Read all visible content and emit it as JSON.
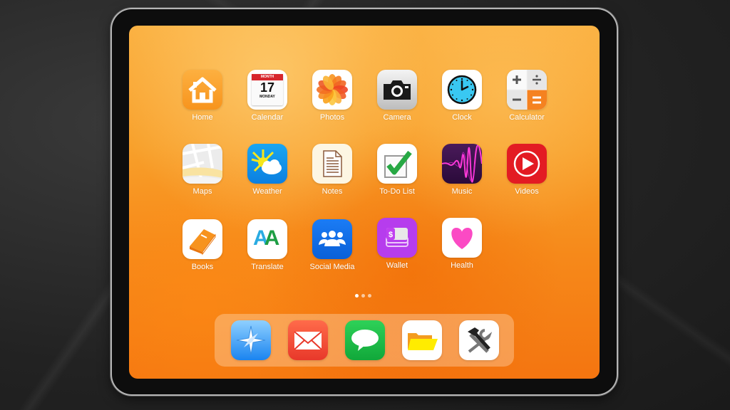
{
  "home_screen": {
    "apps": [
      {
        "label": "Home",
        "icon": "house-icon"
      },
      {
        "label": "Calendar",
        "icon": "calendar-icon",
        "month": "MONTH",
        "day": "17",
        "weekday": "MONDAY"
      },
      {
        "label": "Photos",
        "icon": "photos-flower-icon"
      },
      {
        "label": "Camera",
        "icon": "camera-icon"
      },
      {
        "label": "Clock",
        "icon": "clock-icon"
      },
      {
        "label": "Calculator",
        "icon": "calculator-icon"
      },
      {
        "label": "Maps",
        "icon": "map-icon"
      },
      {
        "label": "Weather",
        "icon": "sun-cloud-icon"
      },
      {
        "label": "Notes",
        "icon": "document-icon"
      },
      {
        "label": "To-Do List",
        "icon": "checkbox-icon"
      },
      {
        "label": "Music",
        "icon": "waveform-icon"
      },
      {
        "label": "Videos",
        "icon": "play-icon"
      },
      {
        "label": "Books",
        "icon": "book-icon"
      },
      {
        "label": "Translate",
        "icon": "translate-aa-icon",
        "glyph": "AA"
      },
      {
        "label": "Social Media",
        "icon": "people-icon"
      },
      {
        "label": "Wallet",
        "icon": "wallet-icon",
        "glyph": "$"
      },
      {
        "label": "Health",
        "icon": "heart-icon"
      }
    ],
    "page_indicator": {
      "pages": 3,
      "current": 1
    }
  },
  "dock": {
    "apps": [
      {
        "name": "Safari",
        "icon": "compass-icon"
      },
      {
        "name": "Mail",
        "icon": "envelope-icon"
      },
      {
        "name": "Messages",
        "icon": "speech-bubble-icon"
      },
      {
        "name": "Files",
        "icon": "folder-icon"
      },
      {
        "name": "Settings",
        "icon": "tools-icon"
      }
    ]
  },
  "colors": {
    "wallpaper": "#f8a02b",
    "dock_bg": "rgba(255,230,200,0.35)"
  }
}
